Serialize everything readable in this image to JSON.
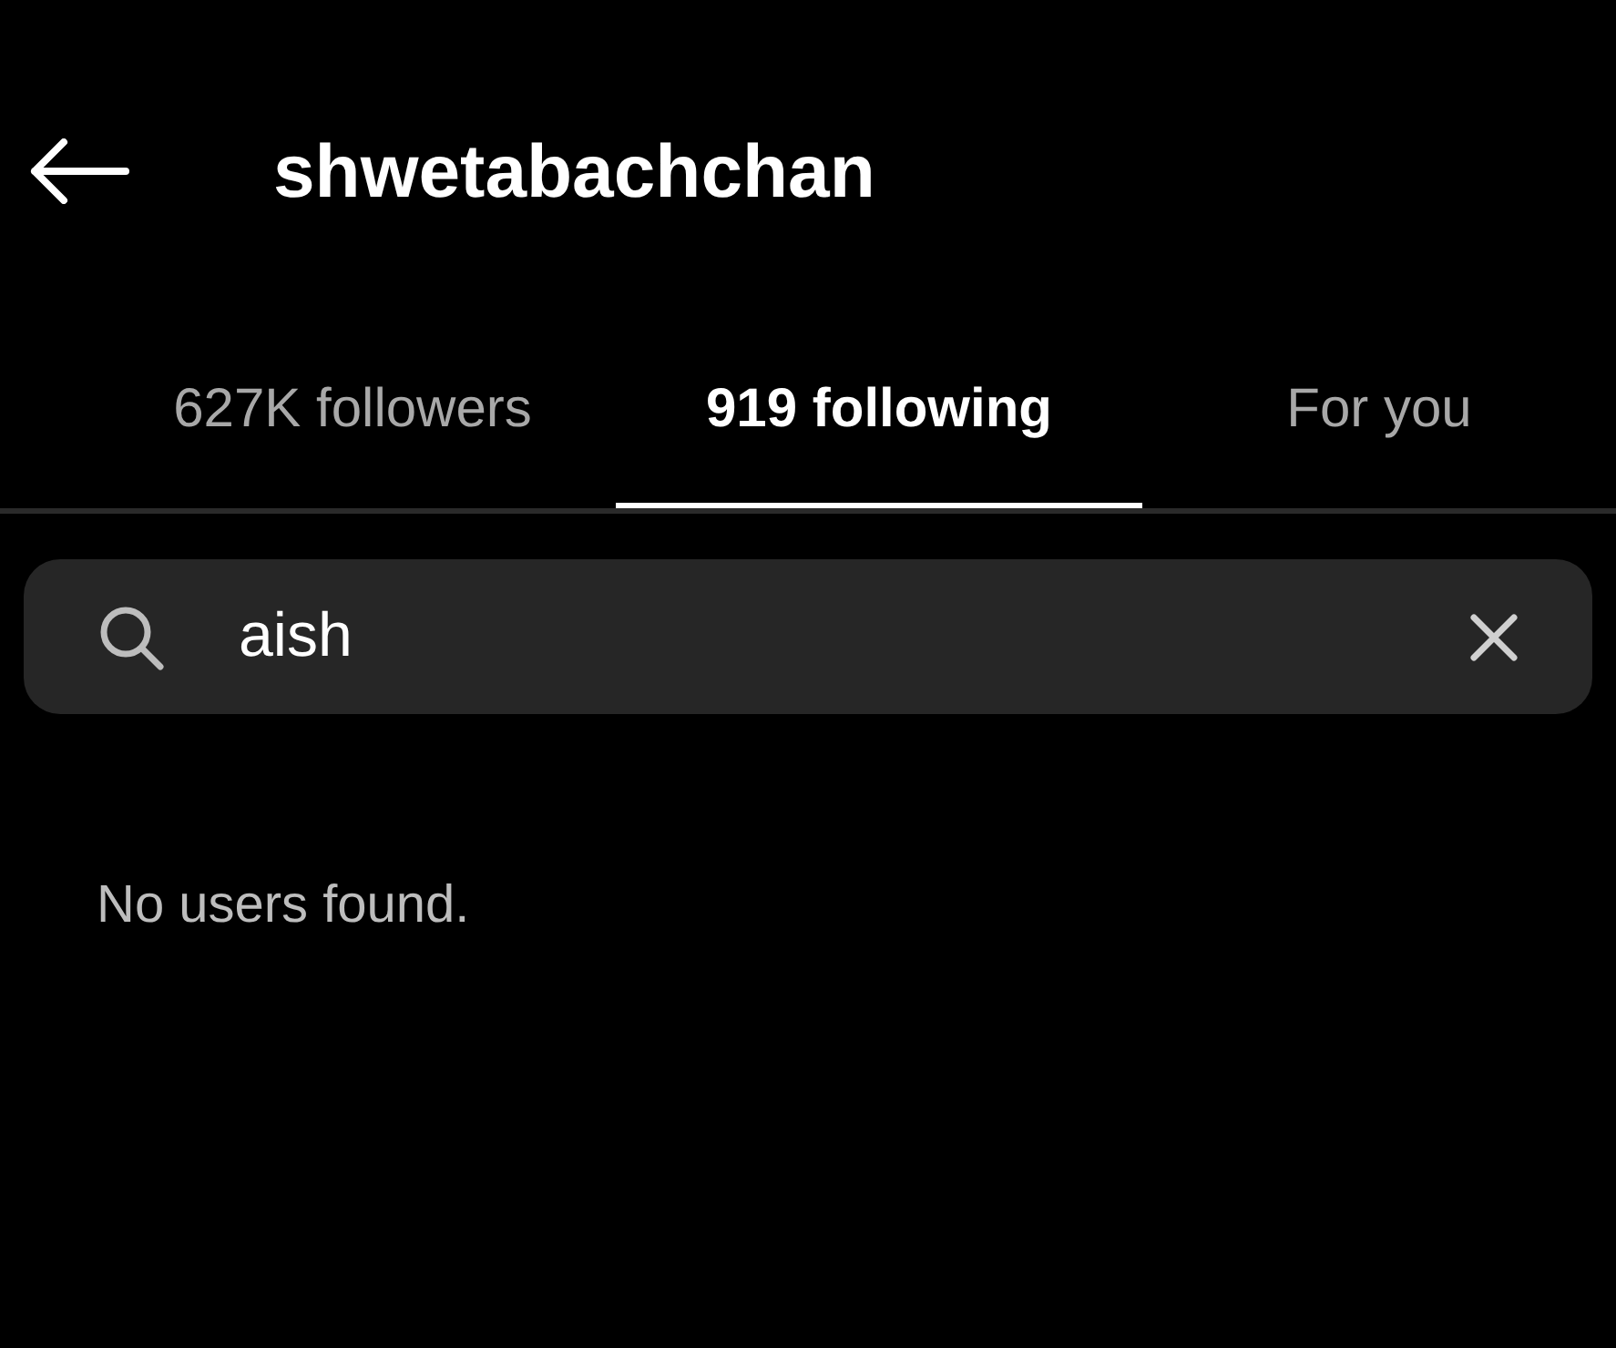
{
  "header": {
    "title": "shwetabachchan"
  },
  "tabs": [
    {
      "label": "627K followers",
      "selected": false
    },
    {
      "label": "919 following",
      "selected": true
    },
    {
      "label": "For you",
      "selected": false
    }
  ],
  "search": {
    "value": "aish"
  },
  "message": "No users found."
}
